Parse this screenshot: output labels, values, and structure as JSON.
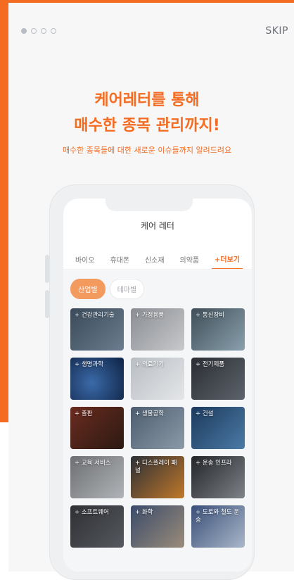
{
  "topbar": {
    "skip_label": "SKIP"
  },
  "headline": {
    "line1": "케어레터를 통해",
    "line2": "매수한 종목 관리까지!",
    "subline": "매수한 종목들에 대한 새로운 이슈들까지 알려드려요"
  },
  "phone": {
    "app_title": "케어 레터",
    "tabs": [
      {
        "label": "바이오"
      },
      {
        "label": "휴대폰"
      },
      {
        "label": "신소재"
      },
      {
        "label": "의약품"
      },
      {
        "label": "+더보기"
      }
    ],
    "filter_chips": [
      {
        "label": "산업별"
      },
      {
        "label": "테마별"
      }
    ],
    "tiles": [
      {
        "label": "+ 건강관리기술"
      },
      {
        "label": "+ 가정용품"
      },
      {
        "label": "+ 통신장비"
      },
      {
        "label": "+ 생명과학"
      },
      {
        "label": "+ 의료기기"
      },
      {
        "label": "+ 전기제품"
      },
      {
        "label": "+ 출판"
      },
      {
        "label": "+ 생물공학"
      },
      {
        "label": "+ 건설"
      },
      {
        "label": "+ 교육 서비스"
      },
      {
        "label": "+ 디스플레이 패널"
      },
      {
        "label": "+ 운송 인프라"
      },
      {
        "label": "+ 소프트웨어"
      },
      {
        "label": "+ 화학"
      },
      {
        "label": "+ 도로와 철도 운송"
      }
    ]
  },
  "colors": {
    "accent": "#f36c21"
  }
}
